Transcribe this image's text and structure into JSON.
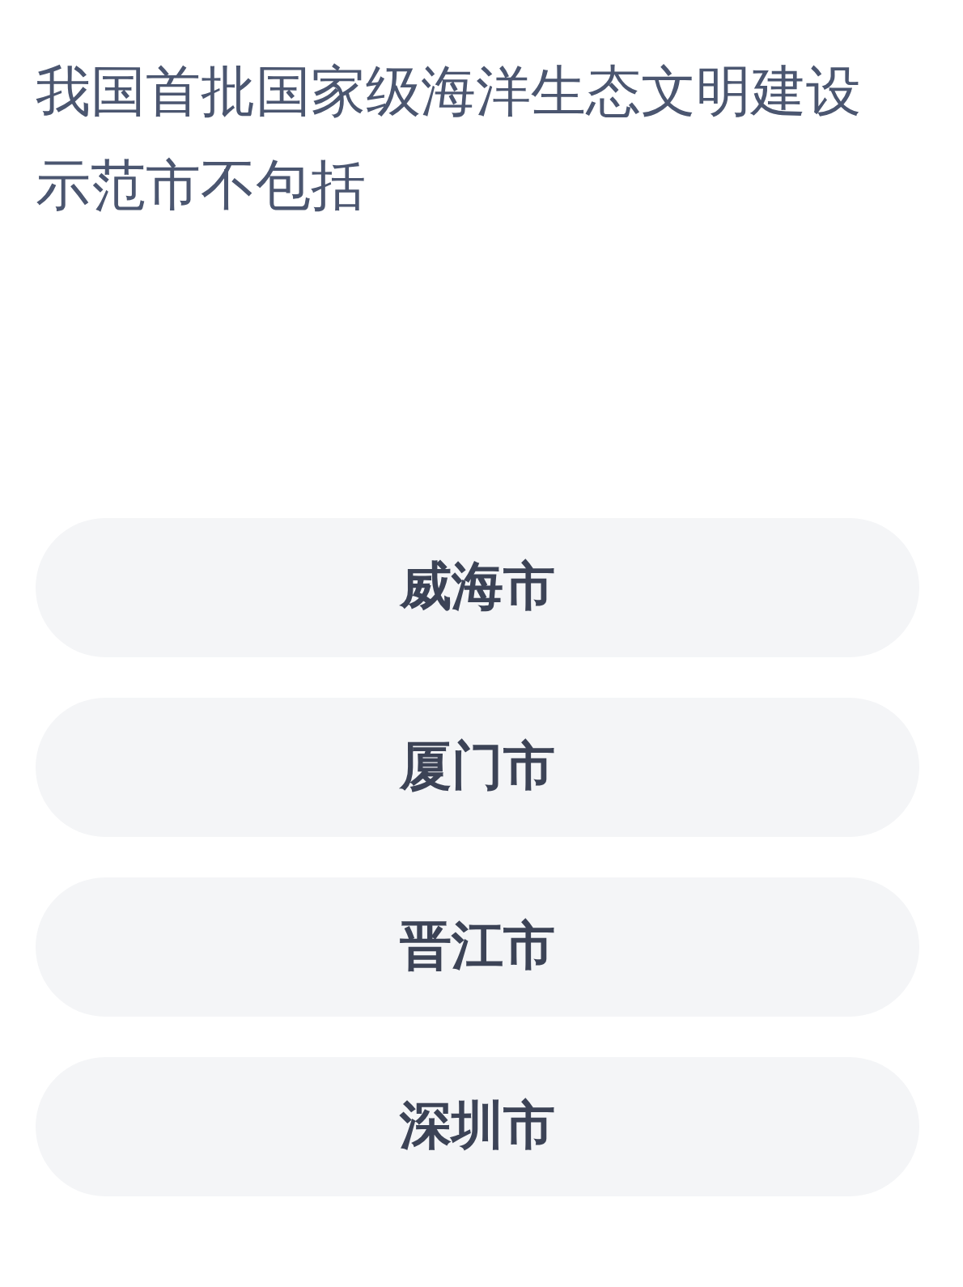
{
  "question": "我国首批国家级海洋生态文明建设示范市不包括",
  "options": [
    {
      "label": "威海市"
    },
    {
      "label": "厦门市"
    },
    {
      "label": "晋江市"
    },
    {
      "label": "深圳市"
    }
  ]
}
